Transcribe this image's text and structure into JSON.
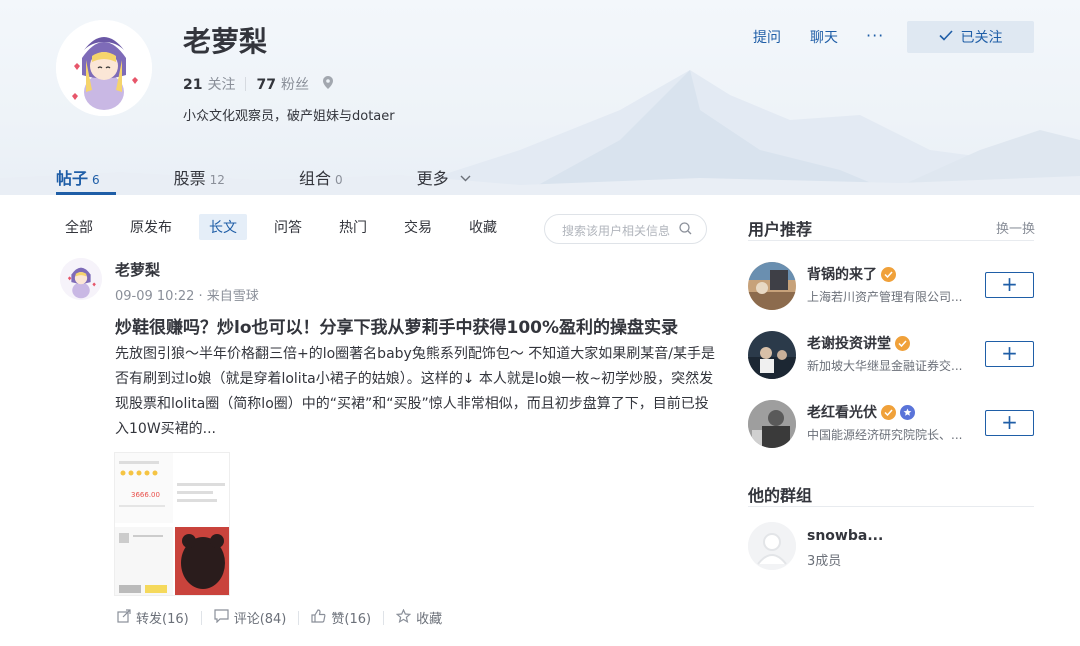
{
  "profile": {
    "name": "老萝梨",
    "following_count": "21",
    "following_label": "关注",
    "followers_count": "77",
    "followers_label": "粉丝",
    "bio": "小众文化观察员，破产姐妹与dotaer"
  },
  "header_actions": {
    "ask": "提问",
    "chat": "聊天",
    "more": "···",
    "followed": "已关注"
  },
  "tabs": [
    {
      "label": "帖子",
      "count": "6"
    },
    {
      "label": "股票",
      "count": "12"
    },
    {
      "label": "组合",
      "count": "0"
    },
    {
      "label": "更多",
      "count": ""
    }
  ],
  "filters": [
    "全部",
    "原发布",
    "长文",
    "问答",
    "热门",
    "交易",
    "收藏"
  ],
  "search": {
    "placeholder": "搜索该用户相关信息"
  },
  "post": {
    "author": "老萝梨",
    "meta": "09-09 10:22 · 来自雪球",
    "title": "炒鞋很赚吗？炒lo也可以！分享下我从萝莉手中获得100%盈利的操盘实录",
    "body": "先放图引狼～半年价格翻三倍+的lo圈著名baby兔熊系列配饰包～ 不知道大家如果刷某音/某手是否有刷到过lo娘（就是穿着lolita小裙子的姑娘）。这样的↓ 本人就是lo娘一枚~初学炒股，突然发现股票和lolita圈（简称lo圈）中的“买裙”和“买股”惊人非常相似，而且初步盘算了下，目前已投入10W买裙的...",
    "thumb_price": "3666.00",
    "actions": {
      "repost": "转发(16)",
      "comment": "评论(84)",
      "like": "赞(16)",
      "collect": "收藏"
    }
  },
  "sidebar": {
    "recommend_title": "用户推荐",
    "refresh": "换一换",
    "users": [
      {
        "name": "背锅的来了",
        "desc": "上海若川资产管理有限公司..."
      },
      {
        "name": "老谢投资讲堂",
        "desc": "新加坡大华继显金融证券交..."
      },
      {
        "name": "老红看光伏",
        "desc": "中国能源经济研究院院长、..."
      }
    ],
    "follow_plus": "+",
    "groups_title": "他的群组",
    "group": {
      "name": "snowba...",
      "members": "3成员"
    }
  },
  "colors": {
    "accent": "#1f5ea7",
    "verified": "#f0a13a",
    "badge_blue": "#5a74d9"
  }
}
